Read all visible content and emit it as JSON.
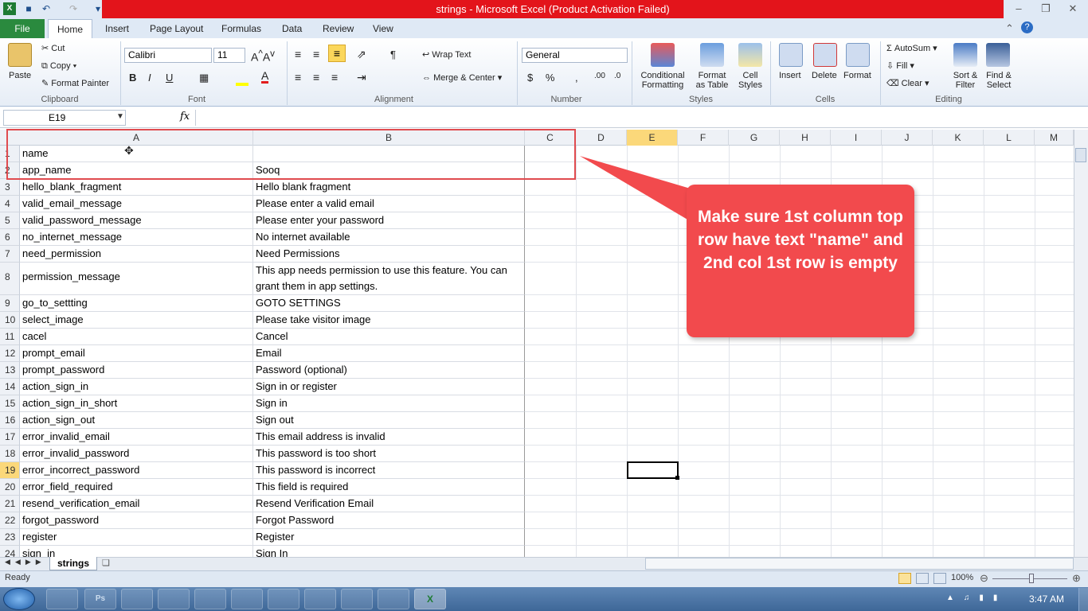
{
  "window": {
    "title": "strings  -  Microsoft Excel (Product Activation Failed)"
  },
  "menu": {
    "tabs": [
      "File",
      "Home",
      "Insert",
      "Page Layout",
      "Formulas",
      "Data",
      "Review",
      "View"
    ]
  },
  "ribbon": {
    "clipboard": {
      "paste": "Paste",
      "cut": "Cut",
      "copy": "Copy",
      "format_painter": "Format Painter",
      "label": "Clipboard"
    },
    "font": {
      "name": "Calibri",
      "size": "11",
      "label": "Font"
    },
    "alignment": {
      "wrap": "Wrap Text",
      "merge": "Merge & Center",
      "label": "Alignment"
    },
    "number": {
      "format": "General",
      "label": "Number"
    },
    "styles": {
      "conditional": "Conditional",
      "conditional2": "Formatting",
      "format_table": "Format",
      "format_table2": "as Table",
      "cell_styles": "Cell",
      "cell_styles2": "Styles",
      "label": "Styles"
    },
    "cells": {
      "insert": "Insert",
      "delete": "Delete",
      "format": "Format",
      "label": "Cells"
    },
    "editing": {
      "autosum": "AutoSum",
      "fill": "Fill",
      "clear": "Clear",
      "sort": "Sort &",
      "sort2": "Filter",
      "find": "Find &",
      "find2": "Select",
      "label": "Editing"
    }
  },
  "formula_bar": {
    "name_box": "E19",
    "fx": "fx"
  },
  "columns": [
    "A",
    "B",
    "C",
    "D",
    "E",
    "F",
    "G",
    "H",
    "I",
    "J",
    "K",
    "L",
    "M"
  ],
  "rows": [
    {
      "n": "1",
      "a": "name",
      "b": ""
    },
    {
      "n": "2",
      "a": "app_name",
      "b": "Sooq"
    },
    {
      "n": "3",
      "a": "hello_blank_fragment",
      "b": "Hello blank fragment"
    },
    {
      "n": "4",
      "a": "valid_email_message",
      "b": "Please enter a valid email"
    },
    {
      "n": "5",
      "a": "valid_password_message",
      "b": "Please enter your password"
    },
    {
      "n": "6",
      "a": "no_internet_message",
      "b": "No internet available"
    },
    {
      "n": "7",
      "a": "need_permission",
      "b": "Need Permissions"
    },
    {
      "n": "8",
      "a": "permission_message",
      "b": "This app needs permission to use this feature. You can grant them in app settings."
    },
    {
      "n": "9",
      "a": "go_to_settting",
      "b": "GOTO SETTINGS"
    },
    {
      "n": "10",
      "a": "select_image",
      "b": "Please take visitor image"
    },
    {
      "n": "11",
      "a": "cacel",
      "b": "Cancel"
    },
    {
      "n": "12",
      "a": "prompt_email",
      "b": "Email"
    },
    {
      "n": "13",
      "a": "prompt_password",
      "b": "Password (optional)"
    },
    {
      "n": "14",
      "a": "action_sign_in",
      "b": "Sign in or register"
    },
    {
      "n": "15",
      "a": "action_sign_in_short",
      "b": "Sign in"
    },
    {
      "n": "16",
      "a": "action_sign_out",
      "b": "Sign out"
    },
    {
      "n": "17",
      "a": "error_invalid_email",
      "b": "This email address is invalid"
    },
    {
      "n": "18",
      "a": "error_invalid_password",
      "b": "This password is too short"
    },
    {
      "n": "19",
      "a": "error_incorrect_password",
      "b": "This password is incorrect"
    },
    {
      "n": "20",
      "a": "error_field_required",
      "b": "This field is required"
    },
    {
      "n": "21",
      "a": "resend_verification_email",
      "b": "Resend Verification Email"
    },
    {
      "n": "22",
      "a": "forgot_password",
      "b": "Forgot Password"
    },
    {
      "n": "23",
      "a": "register",
      "b": "Register"
    },
    {
      "n": "24",
      "a": "sign_in",
      "b": "Sign In"
    }
  ],
  "annotation": {
    "text": "Make sure 1st column top row have text \"name\" and 2nd col 1st row is empty"
  },
  "sheet": {
    "tab": "strings"
  },
  "status": {
    "ready": "Ready",
    "zoom": "100%"
  },
  "taskbar": {
    "time": "3:47 AM"
  }
}
